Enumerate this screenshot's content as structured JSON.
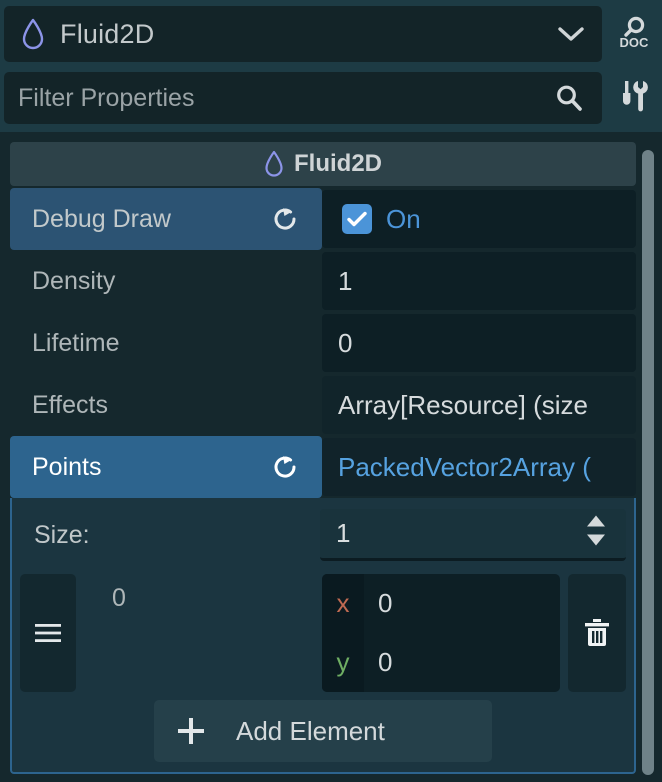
{
  "object_selector": {
    "icon": "fluid-droplet-icon",
    "name": "Fluid2D",
    "dropdown_icon": "chevron-down-icon"
  },
  "side_icons": {
    "doc_search": "doc-search-icon",
    "tools": "tools-icon"
  },
  "filter": {
    "placeholder": "Filter Properties",
    "search_icon": "search-icon"
  },
  "inspector": {
    "category": {
      "icon": "fluid-droplet-icon",
      "title": "Fluid2D"
    },
    "properties": [
      {
        "label": "Debug Draw",
        "value": "On",
        "type": "checkbox",
        "checked": true,
        "has_revert": true,
        "highlight": "soft"
      },
      {
        "label": "Density",
        "value": "1",
        "type": "number",
        "has_revert": false,
        "highlight": "none"
      },
      {
        "label": "Lifetime",
        "value": "0",
        "type": "number",
        "has_revert": false,
        "highlight": "none"
      },
      {
        "label": "Effects",
        "value": "Array[Resource] (size",
        "type": "array",
        "has_revert": false,
        "highlight": "none"
      },
      {
        "label": "Points",
        "value": "PackedVector2Array (",
        "type": "packed_array",
        "has_revert": true,
        "highlight": "strong"
      }
    ],
    "array_editor": {
      "size_label": "Size:",
      "size_value": "1",
      "spinner_icon": "updown-arrows-icon",
      "elements": [
        {
          "drag_handle_icon": "hamburger-drag-icon",
          "index": "0",
          "x_axis_label": "x",
          "x_value": "0",
          "y_axis_label": "y",
          "y_value": "0",
          "delete_icon": "trash-icon"
        }
      ],
      "add_button": {
        "icon": "plus-icon",
        "label": "Add Element"
      }
    }
  },
  "scrollbar": {
    "name": "vertical-scrollbar"
  },
  "colors": {
    "page_bg": "#1d3b44",
    "panel_bg": "#15282d",
    "field_bg": "#0d1f25",
    "accent_blue": "#4b94d8",
    "selection_strong": "#2d648e",
    "selection_soft": "#2c5373",
    "axis_x": "#bf6a52",
    "axis_y": "#6fae63",
    "droplet": "#8c94e8"
  }
}
